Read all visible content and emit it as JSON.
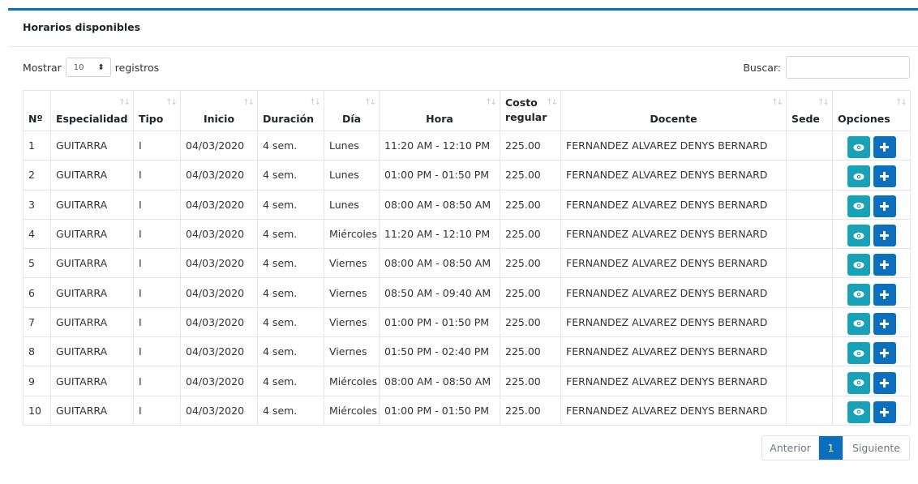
{
  "card": {
    "title": "Horarios disponibles"
  },
  "length_control": {
    "prefix": "Mostrar",
    "value": "10",
    "suffix": "registros"
  },
  "search": {
    "label": "Buscar:",
    "value": ""
  },
  "table": {
    "headers": [
      "Nº",
      "Especialidad",
      "Tipo",
      "Inicio",
      "Duración",
      "Día",
      "Hora",
      "Costo",
      "regular",
      "Docente",
      "Sede",
      "Opciones"
    ],
    "sort_icon": "sort-icon",
    "rows": [
      {
        "n": "1",
        "esp": "GUITARRA",
        "tipo": "I",
        "inicio": "04/03/2020",
        "dur": "4 sem.",
        "dia": "Lunes",
        "hora": "11:20 AM - 12:10 PM",
        "costo": "225.00",
        "docente": "FERNANDEZ ALVAREZ DENYS BERNARD",
        "sede": ""
      },
      {
        "n": "2",
        "esp": "GUITARRA",
        "tipo": "I",
        "inicio": "04/03/2020",
        "dur": "4 sem.",
        "dia": "Lunes",
        "hora": "01:00 PM - 01:50 PM",
        "costo": "225.00",
        "docente": "FERNANDEZ ALVAREZ DENYS BERNARD",
        "sede": ""
      },
      {
        "n": "3",
        "esp": "GUITARRA",
        "tipo": "I",
        "inicio": "04/03/2020",
        "dur": "4 sem.",
        "dia": "Lunes",
        "hora": "08:00 AM - 08:50 AM",
        "costo": "225.00",
        "docente": "FERNANDEZ ALVAREZ DENYS BERNARD",
        "sede": ""
      },
      {
        "n": "4",
        "esp": "GUITARRA",
        "tipo": "I",
        "inicio": "04/03/2020",
        "dur": "4 sem.",
        "dia": "Miércoles",
        "hora": "11:20 AM - 12:10 PM",
        "costo": "225.00",
        "docente": "FERNANDEZ ALVAREZ DENYS BERNARD",
        "sede": ""
      },
      {
        "n": "5",
        "esp": "GUITARRA",
        "tipo": "I",
        "inicio": "04/03/2020",
        "dur": "4 sem.",
        "dia": "Viernes",
        "hora": "08:00 AM - 08:50 AM",
        "costo": "225.00",
        "docente": "FERNANDEZ ALVAREZ DENYS BERNARD",
        "sede": ""
      },
      {
        "n": "6",
        "esp": "GUITARRA",
        "tipo": "I",
        "inicio": "04/03/2020",
        "dur": "4 sem.",
        "dia": "Viernes",
        "hora": "08:50 AM - 09:40 AM",
        "costo": "225.00",
        "docente": "FERNANDEZ ALVAREZ DENYS BERNARD",
        "sede": ""
      },
      {
        "n": "7",
        "esp": "GUITARRA",
        "tipo": "I",
        "inicio": "04/03/2020",
        "dur": "4 sem.",
        "dia": "Viernes",
        "hora": "01:00 PM - 01:50 PM",
        "costo": "225.00",
        "docente": "FERNANDEZ ALVAREZ DENYS BERNARD",
        "sede": ""
      },
      {
        "n": "8",
        "esp": "GUITARRA",
        "tipo": "I",
        "inicio": "04/03/2020",
        "dur": "4 sem.",
        "dia": "Viernes",
        "hora": "01:50 PM - 02:40 PM",
        "costo": "225.00",
        "docente": "FERNANDEZ ALVAREZ DENYS BERNARD",
        "sede": ""
      },
      {
        "n": "9",
        "esp": "GUITARRA",
        "tipo": "I",
        "inicio": "04/03/2020",
        "dur": "4 sem.",
        "dia": "Miércoles",
        "hora": "08:00 AM - 08:50 AM",
        "costo": "225.00",
        "docente": "FERNANDEZ ALVAREZ DENYS BERNARD",
        "sede": ""
      },
      {
        "n": "10",
        "esp": "GUITARRA",
        "tipo": "I",
        "inicio": "04/03/2020",
        "dur": "4 sem.",
        "dia": "Miércoles",
        "hora": "01:00 PM - 01:50 PM",
        "costo": "225.00",
        "docente": "FERNANDEZ ALVAREZ DENYS BERNARD",
        "sede": ""
      }
    ],
    "option_icons": {
      "view": "eye-icon",
      "add": "plus-icon"
    }
  },
  "pagination": {
    "prev": "Anterior",
    "current": "1",
    "next": "Siguiente"
  },
  "colors": {
    "accent": "#0b6fbd",
    "info": "#17a2b8"
  }
}
